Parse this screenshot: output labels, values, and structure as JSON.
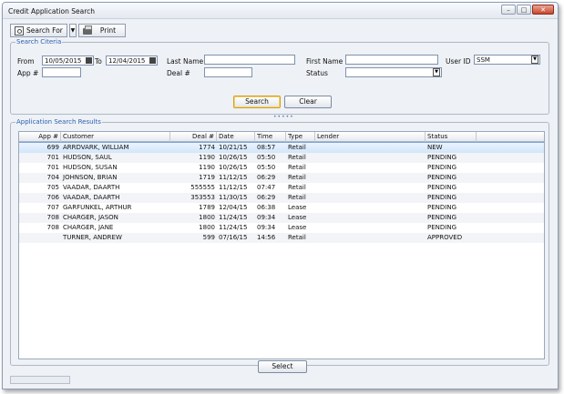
{
  "window": {
    "title": "Credit Application Search"
  },
  "toolbar": {
    "search_for_label": "Search For",
    "print_label": "Print"
  },
  "criteria": {
    "group_title": "Search Citeria",
    "from_label": "From",
    "from_value": "10/05/2015",
    "to_label": "To",
    "to_value": "12/04/2015",
    "last_name_label": "Last Name",
    "last_name_value": "",
    "first_name_label": "First Name",
    "first_name_value": "",
    "user_id_label": "User ID",
    "user_id_value": "SSM",
    "app_label": "App #",
    "app_value": "",
    "deal_label": "Deal #",
    "deal_value": "",
    "status_label": "Status",
    "status_value": "",
    "search_button": "Search",
    "clear_button": "Clear"
  },
  "results": {
    "group_title": "Application Search Results",
    "columns": [
      "App #",
      "Customer",
      "Deal #",
      "Date",
      "Time",
      "Type",
      "Lender",
      "Status"
    ],
    "rows": [
      [
        "699",
        "ARRDVARK, WILLIAM",
        "1774",
        "10/21/15",
        "08:57",
        "Retail",
        "",
        "NEW"
      ],
      [
        "701",
        "HUDSON, SAUL",
        "1190",
        "10/26/15",
        "05:50",
        "Retail",
        "",
        "PENDING"
      ],
      [
        "701",
        "HUDSON, SUSAN",
        "1190",
        "10/26/15",
        "05:50",
        "Retail",
        "",
        "PENDING"
      ],
      [
        "704",
        "JOHNSON, BRIAN",
        "1719",
        "11/12/15",
        "06:29",
        "Retail",
        "",
        "PENDING"
      ],
      [
        "705",
        "VAADAR, DAARTH",
        "555555",
        "11/12/15",
        "07:47",
        "Retail",
        "",
        "PENDING"
      ],
      [
        "706",
        "VAADAR, DAARTH",
        "353553",
        "11/30/15",
        "06:29",
        "Retail",
        "",
        "PENDING"
      ],
      [
        "707",
        "GARFUNKEL, ARTHUR",
        "1789",
        "12/04/15",
        "06:38",
        "Lease",
        "",
        "PENDING"
      ],
      [
        "708",
        "CHARGER, JASON",
        "1800",
        "11/24/15",
        "09:34",
        "Lease",
        "",
        "PENDING"
      ],
      [
        "708",
        "CHARGER, JANE",
        "1800",
        "11/24/15",
        "09:34",
        "Lease",
        "",
        "PENDING"
      ],
      [
        "",
        "TURNER, ANDREW",
        "599",
        "07/16/15",
        "14:56",
        "Retail",
        "",
        "APPROVED"
      ]
    ],
    "selected_row": 0
  },
  "footer": {
    "select_button": "Select"
  },
  "icons": {
    "search": "search-icon",
    "print": "printer-icon",
    "calendar": "calendar-icon"
  }
}
